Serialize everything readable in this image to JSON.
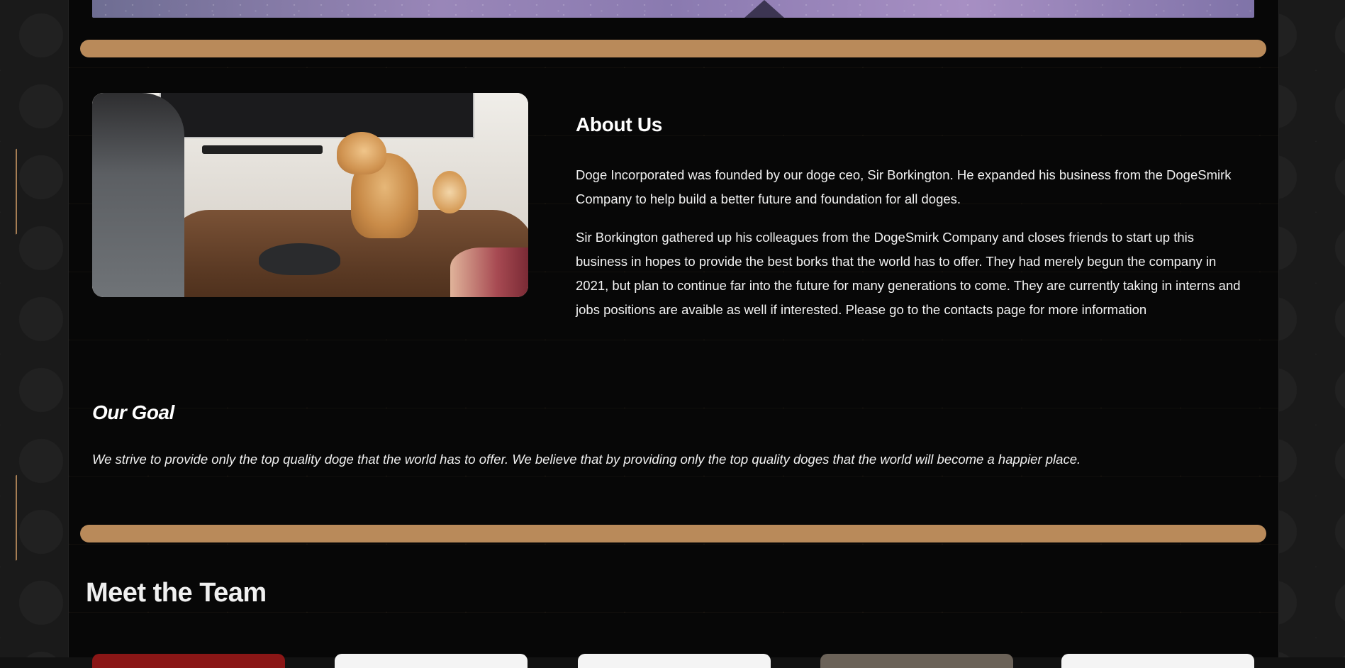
{
  "hero": {
    "image_alt": "starry sky banner"
  },
  "about": {
    "title": "About Us",
    "paragraph_1": "Doge Incorporated was founded by our doge ceo, Sir Borkington. He expanded his business from the DogeSmirk Company to help build a better future and foundation for all doges.",
    "paragraph_2": "Sir Borkington gathered up his colleagues from the DogeSmirk Company and closes friends to start up this business in hopes to provide the best borks that the world has to offer. They had merely begun the company in 2021, but plan to continue far into the future for many generations to come. They are currently taking in interns and jobs positions are avaible as well if interested. Please go to the contacts page for more information",
    "photo_alt": "Shiba inu dog standing on a conference table"
  },
  "goal": {
    "title": "Our Goal",
    "text": "We strive to provide only the top quality doge that the world has to offer. We believe that by providing only the top quality doges that the world will become a happier place."
  },
  "team": {
    "title": "Meet the Team",
    "card_colors": [
      "#8a1616",
      "#f4f4f4",
      "#f4f4f4",
      "#6b6258",
      "#f4f4f4"
    ]
  },
  "colors": {
    "accent": "#b98a5a",
    "background": "#070707",
    "text": "#f2f2f2"
  }
}
